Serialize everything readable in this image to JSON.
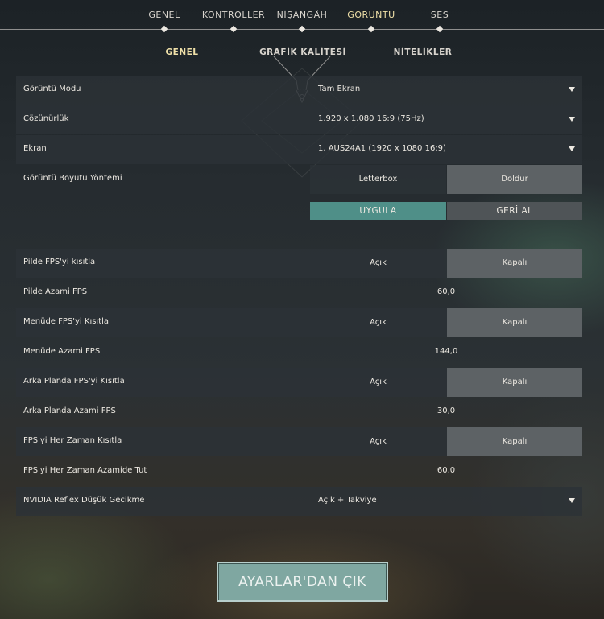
{
  "top_tabs": [
    "GENEL",
    "KONTROLLER",
    "NİŞANGÂH",
    "GÖRÜNTÜ",
    "SES"
  ],
  "sub_tabs": [
    "GENEL",
    "GRAFİK KALİTESİ",
    "NİTELİKLER"
  ],
  "display": {
    "mode_label": "Görüntü Modu",
    "mode_value": "Tam Ekran",
    "resolution_label": "Çözünürlük",
    "resolution_value": "1.920 x 1.080 16:9 (75Hz)",
    "monitor_label": "Ekran",
    "monitor_value": "1. AUS24A1 (1920 x  1080 16:9)",
    "aspect_method_label": "Görüntü Boyutu Yöntemi",
    "aspect_option_a": "Letterbox",
    "aspect_option_b": "Doldur",
    "aspect_selected": "Doldur"
  },
  "actions": {
    "apply": "UYGULA",
    "revert": "GERİ AL"
  },
  "fps": {
    "limit_battery_label": "Pilde FPS'yi kısıtla",
    "limit_battery_on": "Açık",
    "limit_battery_off": "Kapalı",
    "max_battery_label": "Pilde Azami FPS",
    "max_battery_value": "60,0",
    "limit_menu_label": "Menüde FPS'yi Kısıtla",
    "limit_menu_on": "Açık",
    "limit_menu_off": "Kapalı",
    "max_menu_label": "Menüde Azami FPS",
    "max_menu_value": "144,0",
    "limit_background_label": "Arka Planda FPS'yi Kısıtla",
    "limit_background_on": "Açık",
    "limit_background_off": "Kapalı",
    "max_background_label": "Arka Planda Azami FPS",
    "max_background_value": "30,0",
    "limit_always_label": "FPS'yi Her Zaman Kısıtla",
    "limit_always_on": "Açık",
    "limit_always_off": "Kapalı",
    "max_always_label": "FPS'yi Her Zaman Azamide Tut",
    "max_always_value": "60,0",
    "selected_state": "Kapalı"
  },
  "reflex": {
    "label": "NVIDIA Reflex Düşük Gecikme",
    "value": "Açık + Takviye"
  },
  "exit_button": "AYARLAR'DAN ÇIK",
  "colors": {
    "accent": "#4f8f88",
    "active_tab": "#efe0a8",
    "exit_button": "#7fa7a1"
  }
}
